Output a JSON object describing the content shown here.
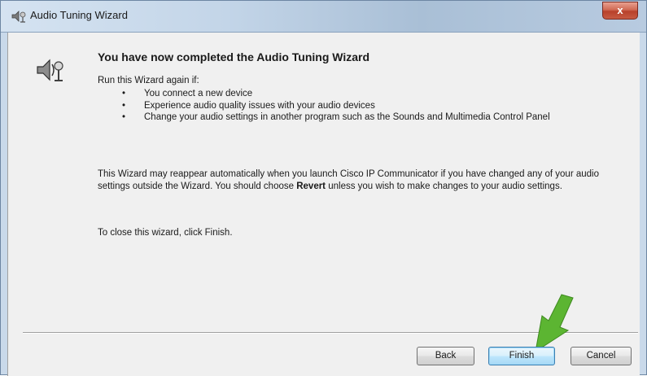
{
  "window": {
    "title": "Audio Tuning Wizard",
    "close_label": "x",
    "title_icon": "speaker-wizard-icon"
  },
  "content": {
    "icon": "speaker-wizard-icon",
    "heading": "You have now completed the Audio Tuning Wizard",
    "run_again": "Run this Wizard again if:",
    "bullets": [
      "You connect a new device",
      "Experience audio quality issues with your audio devices",
      "Change your audio settings in another program such as the Sounds and Multimedia Control Panel"
    ],
    "paragraph_part1": "This Wizard may reappear automatically when you launch Cisco IP Communicator if you have changed any of your audio settings outside the Wizard. You should choose ",
    "paragraph_bold": "Revert",
    "paragraph_part2": " unless you wish to make changes to your audio settings.",
    "close_instruction": "To close this wizard, click Finish."
  },
  "buttons": {
    "back": "Back",
    "finish": "Finish",
    "cancel": "Cancel"
  },
  "colors": {
    "arrow": "#5cb532",
    "close_button": "#c65a42",
    "default_button_border": "#3c7fb1"
  }
}
